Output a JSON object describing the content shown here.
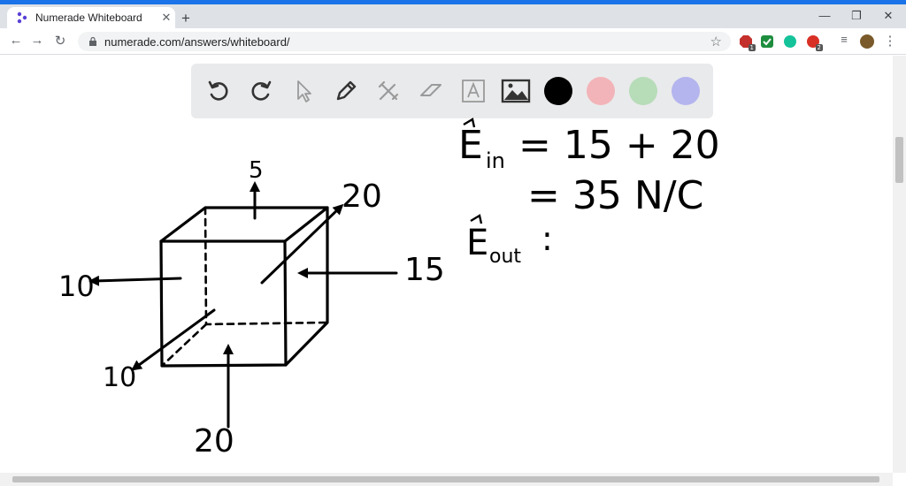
{
  "browser": {
    "tab_title": "Numerade Whiteboard",
    "tab_close": "✕",
    "new_tab": "+",
    "url": "numerade.com/answers/whiteboard/",
    "extensions": [
      {
        "name": "abp",
        "color": "#c4302b",
        "badge": "1"
      },
      {
        "name": "check",
        "color": "#1e8e3e",
        "badge": ""
      },
      {
        "name": "grammarly",
        "color": "#15c39a",
        "badge": ""
      },
      {
        "name": "red-ext",
        "color": "#d93025",
        "badge": "2"
      }
    ],
    "window_controls": {
      "minimize": "—",
      "maximize": "❐",
      "close": "✕"
    }
  },
  "whiteboard": {
    "tools": [
      "undo-icon",
      "redo-icon",
      "pointer-icon",
      "pencil-icon",
      "tools-icon",
      "eraser-icon",
      "text-icon",
      "image-icon"
    ],
    "colors": [
      "#000000",
      "#f2b4b8",
      "#b7dcb8",
      "#b4b4ee"
    ],
    "drawing": {
      "top_label": "5",
      "back_right_label": "20",
      "right_label": "15",
      "left_label": "10",
      "front_left_label": "10",
      "bottom_label": "20",
      "eq1_lhs": "E",
      "eq1_sub": "in",
      "eq1_rhs": "= 15 + 20",
      "eq2": "= 35 N/C",
      "eq3_lhs": "E",
      "eq3_sub": "out",
      "eq3_rhs": ":"
    }
  }
}
